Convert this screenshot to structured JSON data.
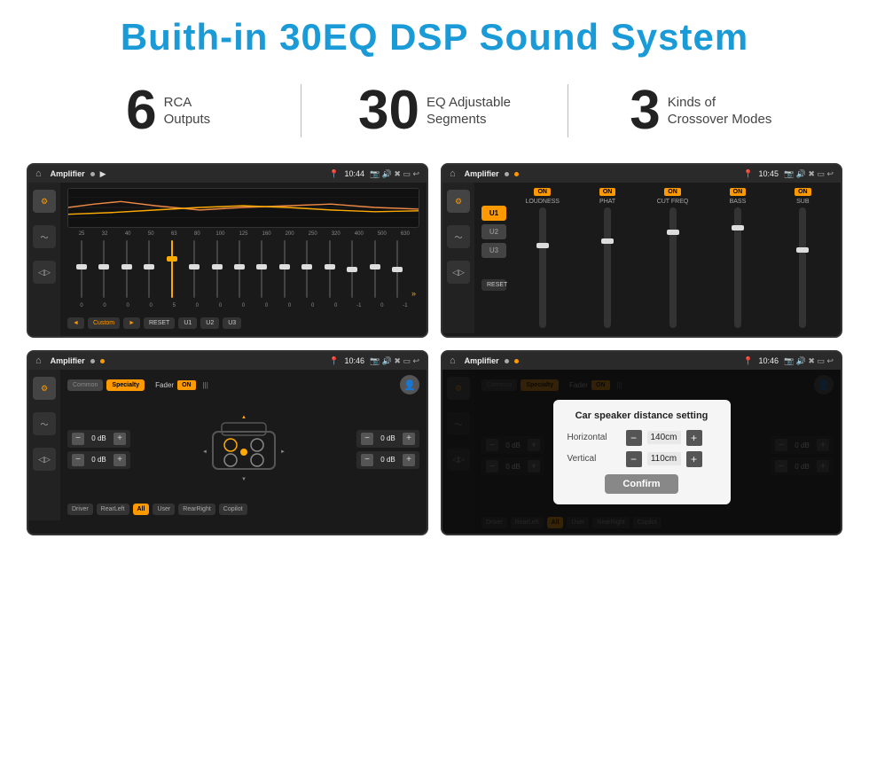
{
  "header": {
    "title": "Buith-in 30EQ DSP Sound System"
  },
  "stats": [
    {
      "number": "6",
      "text_line1": "RCA",
      "text_line2": "Outputs"
    },
    {
      "number": "30",
      "text_line1": "EQ Adjustable",
      "text_line2": "Segments"
    },
    {
      "number": "3",
      "text_line1": "Kinds of",
      "text_line2": "Crossover Modes"
    }
  ],
  "screens": [
    {
      "id": "eq-screen",
      "status_bar": {
        "time": "10:44",
        "app": "Amplifier"
      },
      "type": "eq"
    },
    {
      "id": "crossover-screen",
      "status_bar": {
        "time": "10:45",
        "app": "Amplifier"
      },
      "type": "crossover"
    },
    {
      "id": "fader-screen",
      "status_bar": {
        "time": "10:46",
        "app": "Amplifier"
      },
      "type": "fader"
    },
    {
      "id": "dialog-screen",
      "status_bar": {
        "time": "10:46",
        "app": "Amplifier"
      },
      "type": "fader-dialog"
    }
  ],
  "eq": {
    "freqs": [
      "25",
      "32",
      "40",
      "50",
      "63",
      "80",
      "100",
      "125",
      "160",
      "200",
      "250",
      "320",
      "400",
      "500",
      "630"
    ],
    "values": [
      "0",
      "0",
      "0",
      "0",
      "5",
      "0",
      "0",
      "0",
      "0",
      "0",
      "0",
      "0",
      "-1",
      "0",
      "-1"
    ],
    "preset": "Custom",
    "buttons": [
      "◄",
      "Custom",
      "►",
      "RESET",
      "U1",
      "U2",
      "U3"
    ]
  },
  "crossover": {
    "u_buttons": [
      "U1",
      "U2",
      "U3"
    ],
    "columns": [
      "LOUDNESS",
      "PHAT",
      "CUT FREQ",
      "BASS",
      "SUB"
    ],
    "on_labels": [
      "ON",
      "ON",
      "ON",
      "ON",
      "ON"
    ]
  },
  "fader": {
    "tabs": [
      "Common",
      "Specialty"
    ],
    "fader_label": "Fader",
    "on_label": "ON",
    "vol_rows": [
      {
        "label": "0 dB"
      },
      {
        "label": "0 dB"
      },
      {
        "label": "0 dB"
      },
      {
        "label": "0 dB"
      }
    ],
    "positions": [
      "Driver",
      "RearLeft",
      "All",
      "User",
      "RearRight",
      "Copilot"
    ]
  },
  "dialog": {
    "title": "Car speaker distance setting",
    "rows": [
      {
        "label": "Horizontal",
        "value": "140cm"
      },
      {
        "label": "Vertical",
        "value": "110cm"
      }
    ],
    "confirm_label": "Confirm"
  }
}
